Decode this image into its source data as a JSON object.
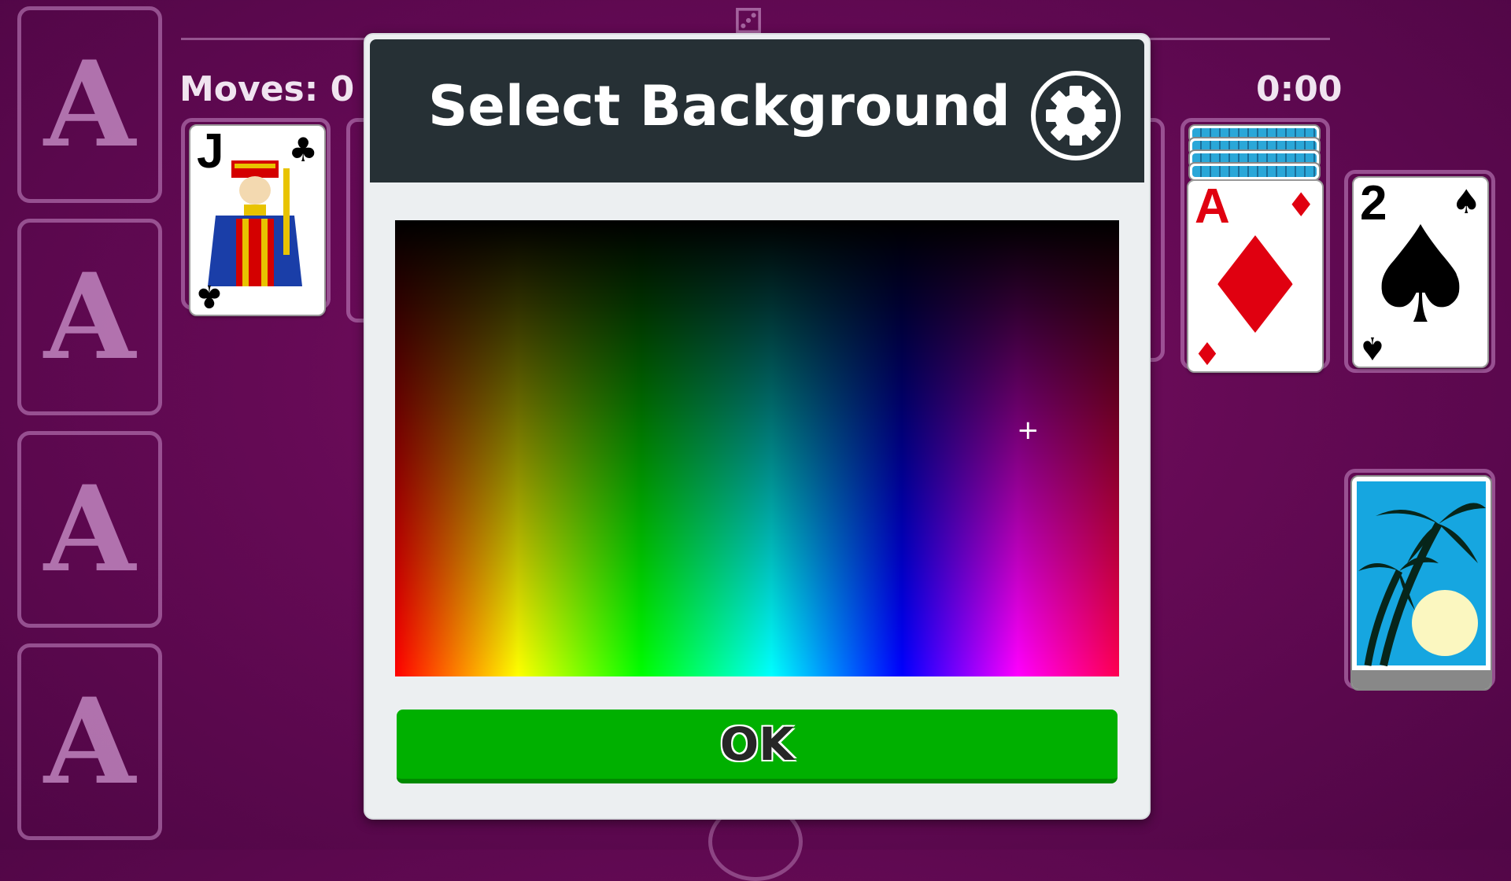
{
  "game": {
    "moves_label": "Moves: 0",
    "timer": "0:00",
    "foundation_letter": "A"
  },
  "tableau": {
    "jack": {
      "rank": "J",
      "suit": "♣",
      "color": "black"
    },
    "ace": {
      "rank": "A",
      "suit": "♦",
      "color": "red"
    },
    "two": {
      "rank": "2",
      "suit": "♠",
      "color": "black"
    }
  },
  "dialog": {
    "title": "Select Background",
    "settings_icon": "gear-icon",
    "ok_label": "OK",
    "crosshair_glyph": "+"
  },
  "colors": {
    "background": "#650a55",
    "header": "#263035",
    "ok_button": "#00b000",
    "card_back": "#2aa7d8"
  }
}
